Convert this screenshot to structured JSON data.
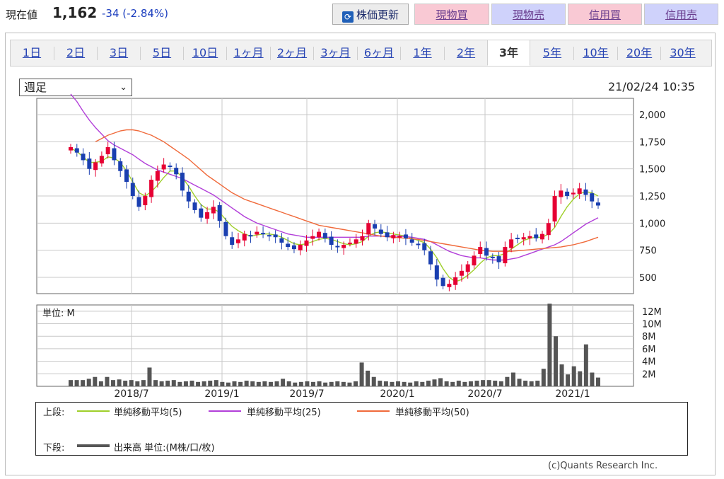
{
  "header": {
    "price_label": "現在値",
    "price_value": "1,162",
    "change": "-34 (-2.84%)",
    "refresh_label": "株価更新",
    "buttons": [
      "現物買",
      "現物売",
      "信用買",
      "信用売"
    ]
  },
  "tabs": [
    "1日",
    "2日",
    "3日",
    "5日",
    "10日",
    "1ヶ月",
    "2ヶ月",
    "3ヶ月",
    "6ヶ月",
    "1年",
    "2年",
    "3年",
    "5年",
    "10年",
    "20年",
    "30年"
  ],
  "active_tab": "3年",
  "period_select": "週足",
  "timestamp": "21/02/24 10:35",
  "volume_unit_label": "単位: M",
  "legend": {
    "upper_label": "上段:",
    "lower_label": "下段:",
    "sma5": "単純移動平均(5)",
    "sma25": "単純移動平均(25)",
    "sma50": "単純移動平均(50)",
    "volume": "出来高 単位:(M株/口/枚)"
  },
  "copyright": "(c)Quants Research Inc.",
  "colors": {
    "up": "#e60033",
    "down": "#1a3fb0",
    "sma5": "#9fcf2a",
    "sma25": "#b23fd9",
    "sma50": "#f06a3b",
    "volume": "#555555"
  },
  "chart_data": [
    {
      "type": "line",
      "title": "",
      "x": [
        "2018/7",
        "2019/1",
        "2019/7",
        "2020/1",
        "2020/7",
        "2021/1"
      ],
      "ylim": [
        350,
        2150
      ],
      "yticks": [
        "2,000",
        "1,750",
        "1,500",
        "1,250",
        "1,000",
        "750",
        "500"
      ],
      "ytick_values": [
        2000,
        1750,
        1500,
        1250,
        1000,
        750,
        500
      ],
      "price_series": [
        1700,
        1650,
        1580,
        1500,
        1560,
        1620,
        1700,
        1580,
        1480,
        1380,
        1250,
        1150,
        1250,
        1400,
        1480,
        1540,
        1520,
        1450,
        1300,
        1200,
        1120,
        1050,
        1100,
        1150,
        1020,
        880,
        800,
        850,
        900,
        880,
        920,
        900,
        880,
        870,
        820,
        780,
        760,
        800,
        840,
        880,
        920,
        860,
        800,
        780,
        800,
        820,
        850,
        880,
        1000,
        950,
        900,
        870,
        890,
        880,
        860,
        820,
        800,
        750,
        620,
        480,
        420,
        440,
        500,
        560,
        620,
        700,
        780,
        700,
        680,
        640,
        780,
        850,
        860,
        870,
        880,
        860,
        900,
        1000,
        1250,
        1300,
        1250,
        1280,
        1320,
        1260,
        1200,
        1162
      ],
      "series": [
        {
          "name": "単純移動平均(5)",
          "values": [
            1690,
            1660,
            1610,
            1560,
            1560,
            1570,
            1610,
            1600,
            1560,
            1480,
            1380,
            1280,
            1250,
            1290,
            1350,
            1420,
            1480,
            1480,
            1420,
            1340,
            1250,
            1170,
            1130,
            1130,
            1100,
            1030,
            970,
            930,
            900,
            880,
            890,
            900,
            900,
            890,
            870,
            840,
            810,
            800,
            810,
            830,
            850,
            860,
            850,
            830,
            810,
            800,
            810,
            830,
            880,
            910,
            920,
            910,
            900,
            890,
            880,
            860,
            840,
            820,
            760,
            680,
            580,
            500,
            460,
            480,
            520,
            570,
            630,
            680,
            700,
            700,
            720,
            760,
            800,
            840,
            860,
            870,
            870,
            900,
            960,
            1060,
            1150,
            1220,
            1270,
            1290,
            1280,
            1250
          ]
        },
        {
          "name": "単純移動平均(25)",
          "values": [
            2190,
            2120,
            2030,
            1950,
            1880,
            1820,
            1760,
            1720,
            1690,
            1660,
            1630,
            1590,
            1550,
            1520,
            1490,
            1470,
            1450,
            1430,
            1410,
            1380,
            1350,
            1320,
            1290,
            1260,
            1220,
            1180,
            1140,
            1100,
            1060,
            1030,
            1000,
            980,
            960,
            940,
            920,
            900,
            890,
            880,
            870,
            870,
            870,
            870,
            870,
            870,
            870,
            870,
            870,
            870,
            880,
            880,
            880,
            880,
            880,
            880,
            875,
            870,
            860,
            850,
            830,
            800,
            770,
            740,
            720,
            700,
            690,
            680,
            680,
            670,
            660,
            660,
            660,
            670,
            680,
            700,
            720,
            740,
            760,
            780,
            800,
            830,
            870,
            910,
            950,
            990,
            1020,
            1050
          ]
        },
        {
          "name": "単純移動平均(50)",
          "values": [
            null,
            null,
            null,
            null,
            1750,
            1780,
            1810,
            1830,
            1850,
            1860,
            1860,
            1850,
            1830,
            1810,
            1780,
            1750,
            1710,
            1670,
            1630,
            1590,
            1540,
            1490,
            1440,
            1400,
            1360,
            1320,
            1280,
            1250,
            1220,
            1200,
            1180,
            1160,
            1140,
            1120,
            1100,
            1080,
            1060,
            1040,
            1020,
            1000,
            980,
            970,
            960,
            950,
            940,
            930,
            920,
            910,
            900,
            890,
            880,
            875,
            870,
            865,
            860,
            855,
            850,
            840,
            830,
            820,
            810,
            800,
            790,
            780,
            770,
            760,
            750,
            745,
            740,
            740,
            740,
            740,
            745,
            750,
            755,
            760,
            765,
            770,
            775,
            780,
            790,
            800,
            815,
            830,
            850,
            870
          ]
        }
      ]
    },
    {
      "type": "bar",
      "title": "",
      "ylabel": "単位: M",
      "ylim": [
        0,
        13
      ],
      "yticks": [
        "12M",
        "10M",
        "8M",
        "6M",
        "4M",
        "2M"
      ],
      "ytick_values": [
        12,
        10,
        8,
        6,
        4,
        2
      ],
      "values": [
        1,
        1,
        1,
        1.2,
        1.5,
        0.8,
        1.5,
        1,
        1.1,
        0.9,
        1,
        0.8,
        1,
        3,
        1,
        0.8,
        0.9,
        1,
        0.7,
        0.8,
        0.9,
        0.7,
        0.8,
        0.9,
        1,
        0.7,
        0.6,
        0.8,
        0.7,
        0.9,
        0.8,
        0.7,
        0.8,
        0.7,
        0.8,
        1.2,
        0.8,
        0.6,
        0.7,
        0.8,
        0.7,
        0.8,
        0.6,
        0.7,
        0.8,
        0.7,
        0.6,
        0.8,
        3.8,
        2.5,
        1.5,
        0.9,
        0.8,
        0.7,
        0.8,
        0.7,
        0.6,
        0.8,
        0.7,
        0.9,
        1.1,
        1.3,
        0.8,
        0.7,
        0.9,
        0.7,
        0.8,
        0.9,
        1,
        1,
        0.9,
        0.8,
        1.5,
        2.2,
        1.2,
        0.9,
        0.8,
        0.9,
        2.8,
        13.2,
        8,
        3.5,
        1.9,
        3.2,
        2.4,
        6.7,
        2.2,
        1.4
      ]
    }
  ]
}
